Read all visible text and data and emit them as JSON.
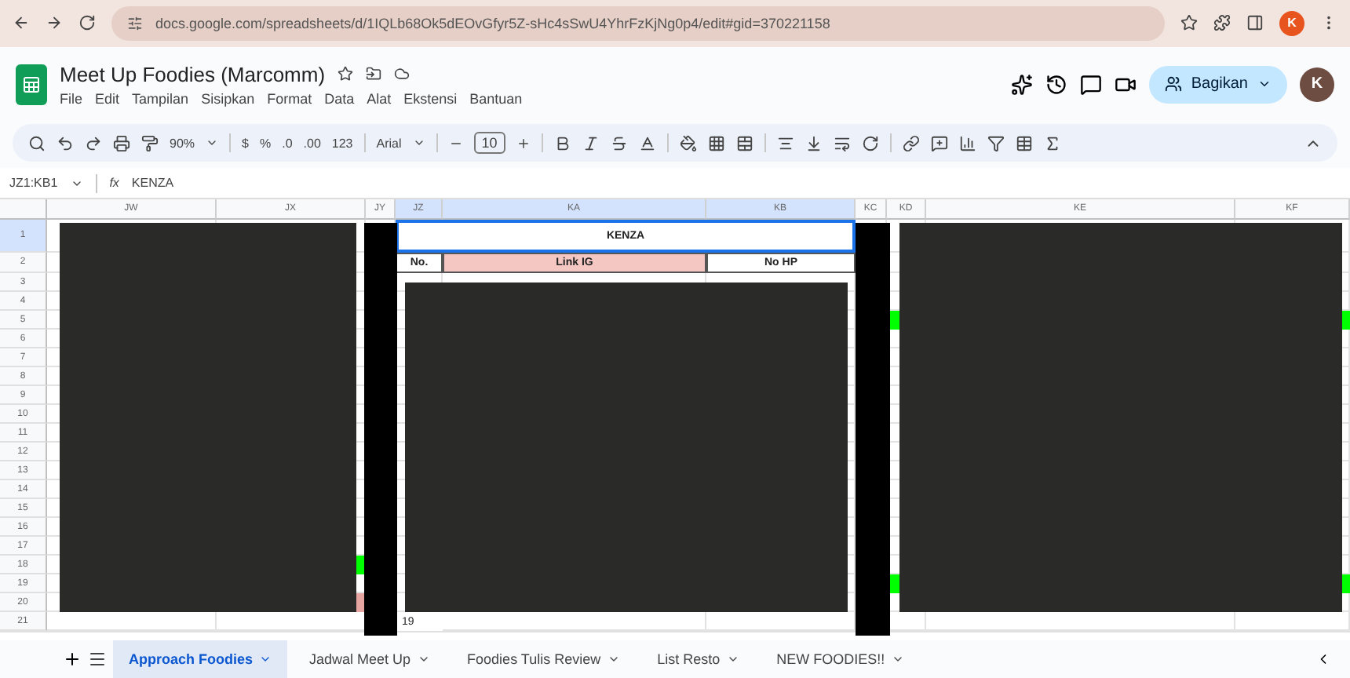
{
  "browser": {
    "url": "docs.google.com/spreadsheets/d/1IQLb68Ok5dEOvGfyr5Z-sHc4sSwU4YhrFzKjNg0p4/edit#gid=370221158",
    "profile": "K"
  },
  "document": {
    "title": "Meet Up Foodies (Marcomm)",
    "starred": false,
    "menus": [
      "File",
      "Edit",
      "Tampilan",
      "Sisipkan",
      "Format",
      "Data",
      "Alat",
      "Ekstensi",
      "Bantuan"
    ],
    "share": "Bagikan",
    "avatar": "K"
  },
  "toolbar": {
    "zoom": "90%",
    "currency": "$",
    "percent": "%",
    "decrease_decimal": ".0",
    "increase_decimal": ".00",
    "number_format": "123",
    "font": "Arial",
    "font_size": "10"
  },
  "formula_bar": {
    "range": "JZ1:KB1",
    "fx_label": "fx",
    "value": "KENZA"
  },
  "sheet": {
    "columns": [
      {
        "label": "JW",
        "selected": false
      },
      {
        "label": "JX",
        "selected": false
      },
      {
        "label": "JY",
        "selected": false
      },
      {
        "label": "JZ",
        "selected": true
      },
      {
        "label": "KA",
        "selected": true
      },
      {
        "label": "KB",
        "selected": true
      },
      {
        "label": "KC",
        "selected": false
      },
      {
        "label": "KD",
        "selected": false
      },
      {
        "label": "KE",
        "selected": false
      },
      {
        "label": "KF",
        "selected": false
      }
    ],
    "rows": [
      {
        "label": "1",
        "selected": true
      },
      {
        "label": "2",
        "selected": false
      },
      {
        "label": "3",
        "selected": false
      },
      {
        "label": "4",
        "selected": false
      },
      {
        "label": "5",
        "selected": false
      },
      {
        "label": "6",
        "selected": false
      },
      {
        "label": "7",
        "selected": false
      },
      {
        "label": "8",
        "selected": false
      },
      {
        "label": "9",
        "selected": false
      },
      {
        "label": "10",
        "selected": false
      },
      {
        "label": "11",
        "selected": false
      },
      {
        "label": "12",
        "selected": false
      },
      {
        "label": "13",
        "selected": false
      },
      {
        "label": "14",
        "selected": false
      },
      {
        "label": "15",
        "selected": false
      },
      {
        "label": "16",
        "selected": false
      },
      {
        "label": "17",
        "selected": false
      },
      {
        "label": "18",
        "selected": false
      },
      {
        "label": "19",
        "selected": false
      },
      {
        "label": "20",
        "selected": false
      },
      {
        "label": "21",
        "selected": false
      }
    ],
    "cells": [
      {
        "text": "KENZA",
        "selected": true
      },
      {
        "text": "No.",
        "selected": false
      },
      {
        "text": "Link IG",
        "color": "#f4c7c3",
        "selected": false
      },
      {
        "text": "No HP",
        "selected": false
      },
      {
        "text": "19",
        "selected": false
      },
      {
        "color": "#00ff00",
        "selected": false
      },
      {
        "color": "#00ff00",
        "selected": false
      },
      {
        "color": "#00ff00",
        "selected": false
      },
      {
        "color": "#00ff00",
        "selected": false
      },
      {
        "color": "#00ff00",
        "selected": false
      },
      {
        "color": "#e6a5a0",
        "selected": false
      }
    ],
    "redactions": [
      {
        "kind": "dark"
      },
      {
        "kind": "black"
      },
      {
        "kind": "dark"
      },
      {
        "kind": "black"
      },
      {
        "kind": "dark"
      }
    ]
  },
  "sheet_tabs": [
    {
      "label": "Approach Foodies",
      "selected": true
    },
    {
      "label": "Jadwal Meet Up",
      "selected": false
    },
    {
      "label": "Foodies Tulis Review",
      "selected": false
    },
    {
      "label": "List Resto",
      "selected": false
    },
    {
      "label": "NEW FOODIES!!",
      "selected": false
    }
  ]
}
